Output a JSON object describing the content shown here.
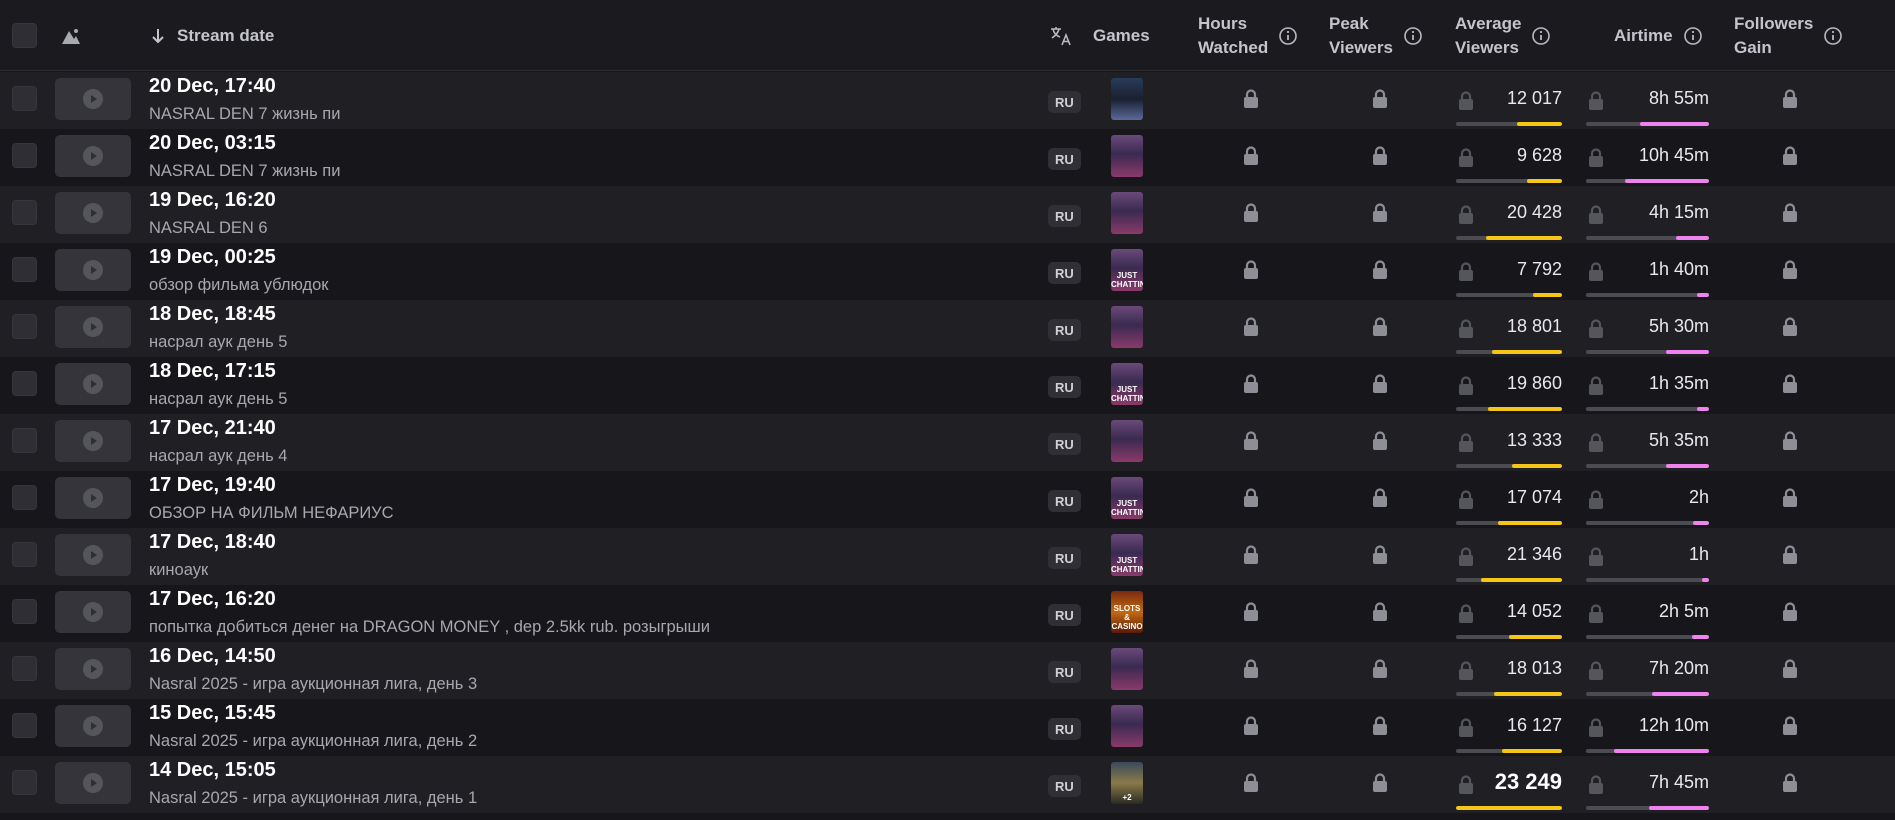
{
  "header": {
    "stream_date": "Stream date",
    "games": "Games",
    "hours_watched_line1": "Hours",
    "hours_watched_line2": "Watched",
    "peak_viewers_line1": "Peak",
    "peak_viewers_line2": "Viewers",
    "average_viewers_line1": "Average",
    "average_viewers_line2": "Viewers",
    "airtime": "Airtime",
    "followers_gain_line1": "Followers",
    "followers_gain_line2": "Gain",
    "sort_icon": "arrow-down-icon",
    "language_icon": "translate-icon",
    "info_icon": "info-icon"
  },
  "colors": {
    "average_bar": "#f5c518",
    "airtime_bar": "#ee82ee",
    "row_odd": "#1f1f24",
    "row_even": "#17171b"
  },
  "rows": [
    {
      "date": "20 Dec, 17:40",
      "title": "NASRAL DEN 7 жизнь пи",
      "lang": "RU",
      "game_art": "portrait",
      "game_text": "",
      "avg_viewers": "12 017",
      "avg_fill": 0.42,
      "airtime": "8h 55m",
      "air_fill": 0.56
    },
    {
      "date": "20 Dec, 03:15",
      "title": "NASRAL DEN 7 жизнь пи",
      "lang": "RU",
      "game_art": "avatar",
      "game_text": "",
      "avg_viewers": "9 628",
      "avg_fill": 0.33,
      "airtime": "10h 45m",
      "air_fill": 0.68
    },
    {
      "date": "19 Dec, 16:20",
      "title": "NASRAL DEN 6",
      "lang": "RU",
      "game_art": "avatar",
      "game_text": "",
      "avg_viewers": "20 428",
      "avg_fill": 0.72,
      "airtime": "4h 15m",
      "air_fill": 0.27
    },
    {
      "date": "19 Dec, 00:25",
      "title": "обзор фильма ублюдок",
      "lang": "RU",
      "game_art": "avatar",
      "game_text": "JUST CHATTING",
      "avg_viewers": "7 792",
      "avg_fill": 0.27,
      "airtime": "1h 40m",
      "air_fill": 0.1
    },
    {
      "date": "18 Dec, 18:45",
      "title": "насрал аук день 5",
      "lang": "RU",
      "game_art": "avatar",
      "game_text": "",
      "avg_viewers": "18 801",
      "avg_fill": 0.66,
      "airtime": "5h 30m",
      "air_fill": 0.35
    },
    {
      "date": "18 Dec, 17:15",
      "title": "насрал аук день 5",
      "lang": "RU",
      "game_art": "avatar",
      "game_text": "JUST CHATTING",
      "avg_viewers": "19 860",
      "avg_fill": 0.7,
      "airtime": "1h 35m",
      "air_fill": 0.1
    },
    {
      "date": "17 Dec, 21:40",
      "title": "насрал аук день 4",
      "lang": "RU",
      "game_art": "avatar",
      "game_text": "",
      "avg_viewers": "13 333",
      "avg_fill": 0.47,
      "airtime": "5h 35m",
      "air_fill": 0.35
    },
    {
      "date": "17 Dec, 19:40",
      "title": "ОБЗОР НА ФИЛЬМ НЕФАРИУС",
      "lang": "RU",
      "game_art": "avatar",
      "game_text": "JUST CHATTING",
      "avg_viewers": "17 074",
      "avg_fill": 0.6,
      "airtime": "2h",
      "air_fill": 0.13
    },
    {
      "date": "17 Dec, 18:40",
      "title": "киноаук",
      "lang": "RU",
      "game_art": "avatar",
      "game_text": "JUST CHATTING",
      "avg_viewers": "21 346",
      "avg_fill": 0.76,
      "airtime": "1h",
      "air_fill": 0.06
    },
    {
      "date": "17 Dec, 16:20",
      "title": "попытка добиться денег на DRAGON MONEY , dep 2.5kk rub. розыгрыши",
      "lang": "RU",
      "game_art": "slots",
      "game_text": "SLOTS & CASINO",
      "avg_viewers": "14 052",
      "avg_fill": 0.5,
      "airtime": "2h 5m",
      "air_fill": 0.14
    },
    {
      "date": "16 Dec, 14:50",
      "title": "Nasral 2025 - игра аукционная лига, день 3",
      "lang": "RU",
      "game_art": "avatar",
      "game_text": "",
      "avg_viewers": "18 013",
      "avg_fill": 0.64,
      "airtime": "7h 20m",
      "air_fill": 0.46
    },
    {
      "date": "15 Dec, 15:45",
      "title": "Nasral 2025 - игра аукционная лига, день 2",
      "lang": "RU",
      "game_art": "avatar",
      "game_text": "",
      "avg_viewers": "16 127",
      "avg_fill": 0.57,
      "airtime": "12h 10m",
      "air_fill": 0.77
    },
    {
      "date": "14 Dec, 15:05",
      "title": "Nasral 2025 - игра аукционная лига, день 1",
      "lang": "RU",
      "game_art": "field",
      "game_text": "+2",
      "avg_viewers": "23 249",
      "avg_fill": 1.0,
      "airtime": "7h 45m",
      "air_fill": 0.49,
      "highlight": true
    }
  ]
}
